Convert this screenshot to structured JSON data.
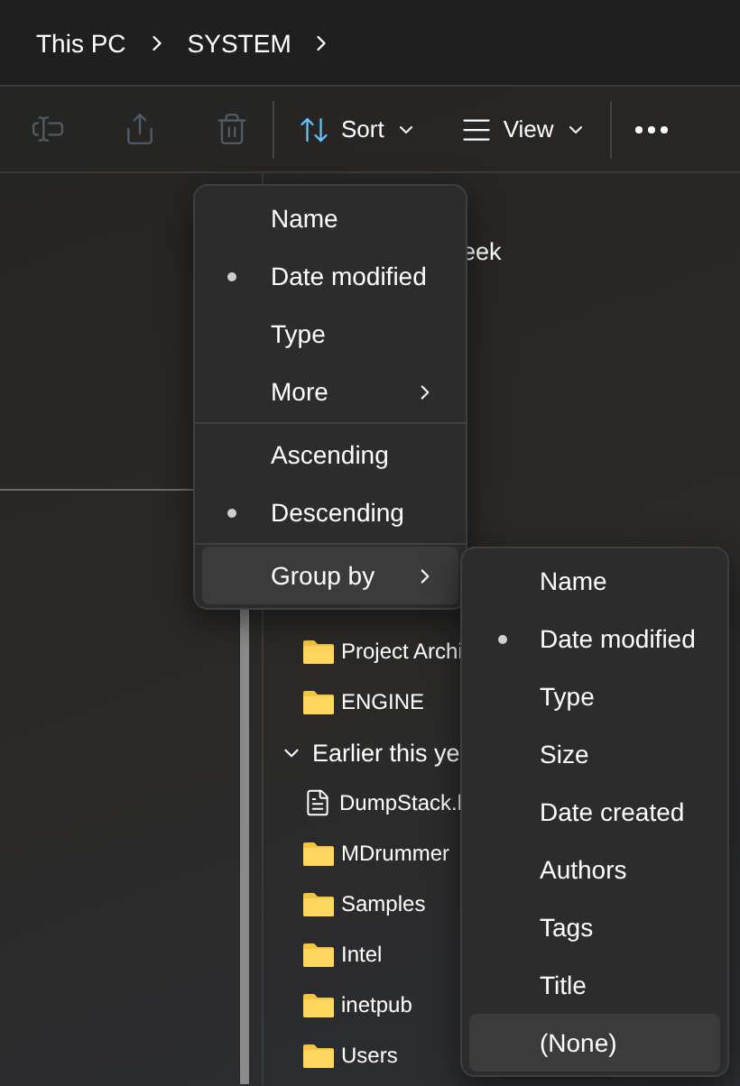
{
  "breadcrumb": [
    {
      "label": "This PC"
    },
    {
      "label": "SYSTEM"
    }
  ],
  "toolbar": {
    "groups": [
      [
        {
          "kind": "rename",
          "disabled": true
        },
        {
          "kind": "share",
          "disabled": true
        },
        {
          "kind": "delete",
          "disabled": true
        }
      ],
      [
        {
          "kind": "sort",
          "label": "Sort"
        },
        {
          "kind": "view",
          "label": "View"
        }
      ],
      [
        {
          "kind": "more"
        }
      ]
    ]
  },
  "content": {
    "groups": [
      {
        "header": "eek",
        "items": [
          {
            "name": "Project Archi",
            "kind": "folder"
          },
          {
            "name": "ENGINE",
            "kind": "folder"
          }
        ]
      },
      {
        "header": "Earlier this ye",
        "expanded": true,
        "items": [
          {
            "name": "DumpStack.l",
            "kind": "file"
          },
          {
            "name": "MDrummer",
            "kind": "folder"
          },
          {
            "name": "Samples",
            "kind": "folder"
          },
          {
            "name": "Intel",
            "kind": "folder"
          },
          {
            "name": "inetpub",
            "kind": "folder"
          },
          {
            "name": "Users",
            "kind": "folder"
          }
        ]
      }
    ]
  },
  "sort_menu": {
    "sections": [
      [
        {
          "label": "Name",
          "kind": "option",
          "selected": false,
          "highlighted": false
        },
        {
          "label": "Date modified",
          "kind": "option",
          "selected": true,
          "highlighted": false
        },
        {
          "label": "Type",
          "kind": "option",
          "selected": false,
          "highlighted": false
        },
        {
          "label": "More",
          "kind": "submenu",
          "selected": false,
          "highlighted": false
        }
      ],
      [
        {
          "label": "Ascending",
          "kind": "option",
          "selected": false,
          "highlighted": false
        },
        {
          "label": "Descending",
          "kind": "option",
          "selected": true,
          "highlighted": false
        }
      ],
      [
        {
          "label": "Group by",
          "kind": "submenu",
          "selected": false,
          "highlighted": true
        }
      ]
    ]
  },
  "group_by_menu": {
    "items": [
      {
        "label": "Name",
        "selected": false,
        "highlighted": false
      },
      {
        "label": "Date modified",
        "selected": true,
        "highlighted": false
      },
      {
        "label": "Type",
        "selected": false,
        "highlighted": false
      },
      {
        "label": "Size",
        "selected": false,
        "highlighted": false
      },
      {
        "label": "Date created",
        "selected": false,
        "highlighted": false
      },
      {
        "label": "Authors",
        "selected": false,
        "highlighted": false
      },
      {
        "label": "Tags",
        "selected": false,
        "highlighted": false
      },
      {
        "label": "Title",
        "selected": false,
        "highlighted": false
      },
      {
        "label": "(None)",
        "selected": false,
        "highlighted": true
      }
    ]
  }
}
